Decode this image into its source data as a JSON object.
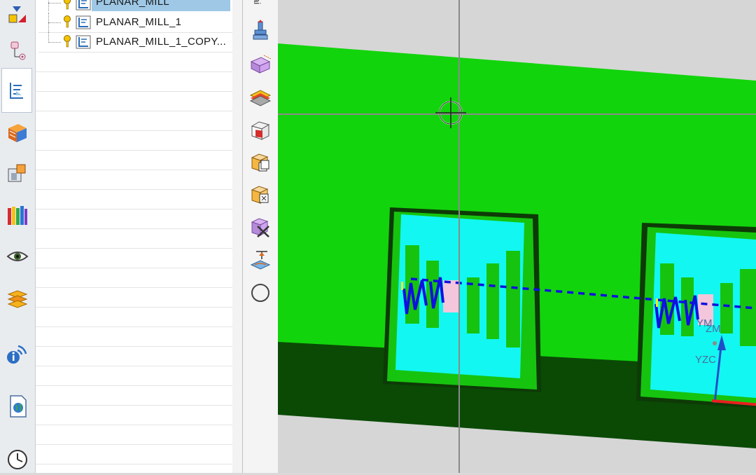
{
  "navigator": {
    "operations": [
      {
        "name": "PLANAR_MILL"
      },
      {
        "name": "PLANAR_MILL_1"
      },
      {
        "name": "PLANAR_MILL_1_COPY..."
      }
    ]
  },
  "tool_column": {
    "header_glyph": "ai"
  },
  "viewport": {
    "wcs_labels": {
      "ym": "YM",
      "zm": "ZM",
      "yzc": "YZC"
    }
  },
  "colors": {
    "part_green": "#12d40c",
    "part_dark_green": "#0a4a05",
    "pocket_floor_cyan": "#12f7f1",
    "toolpath_blue": "#1010e0",
    "selected_row": "#9ec8e6"
  }
}
